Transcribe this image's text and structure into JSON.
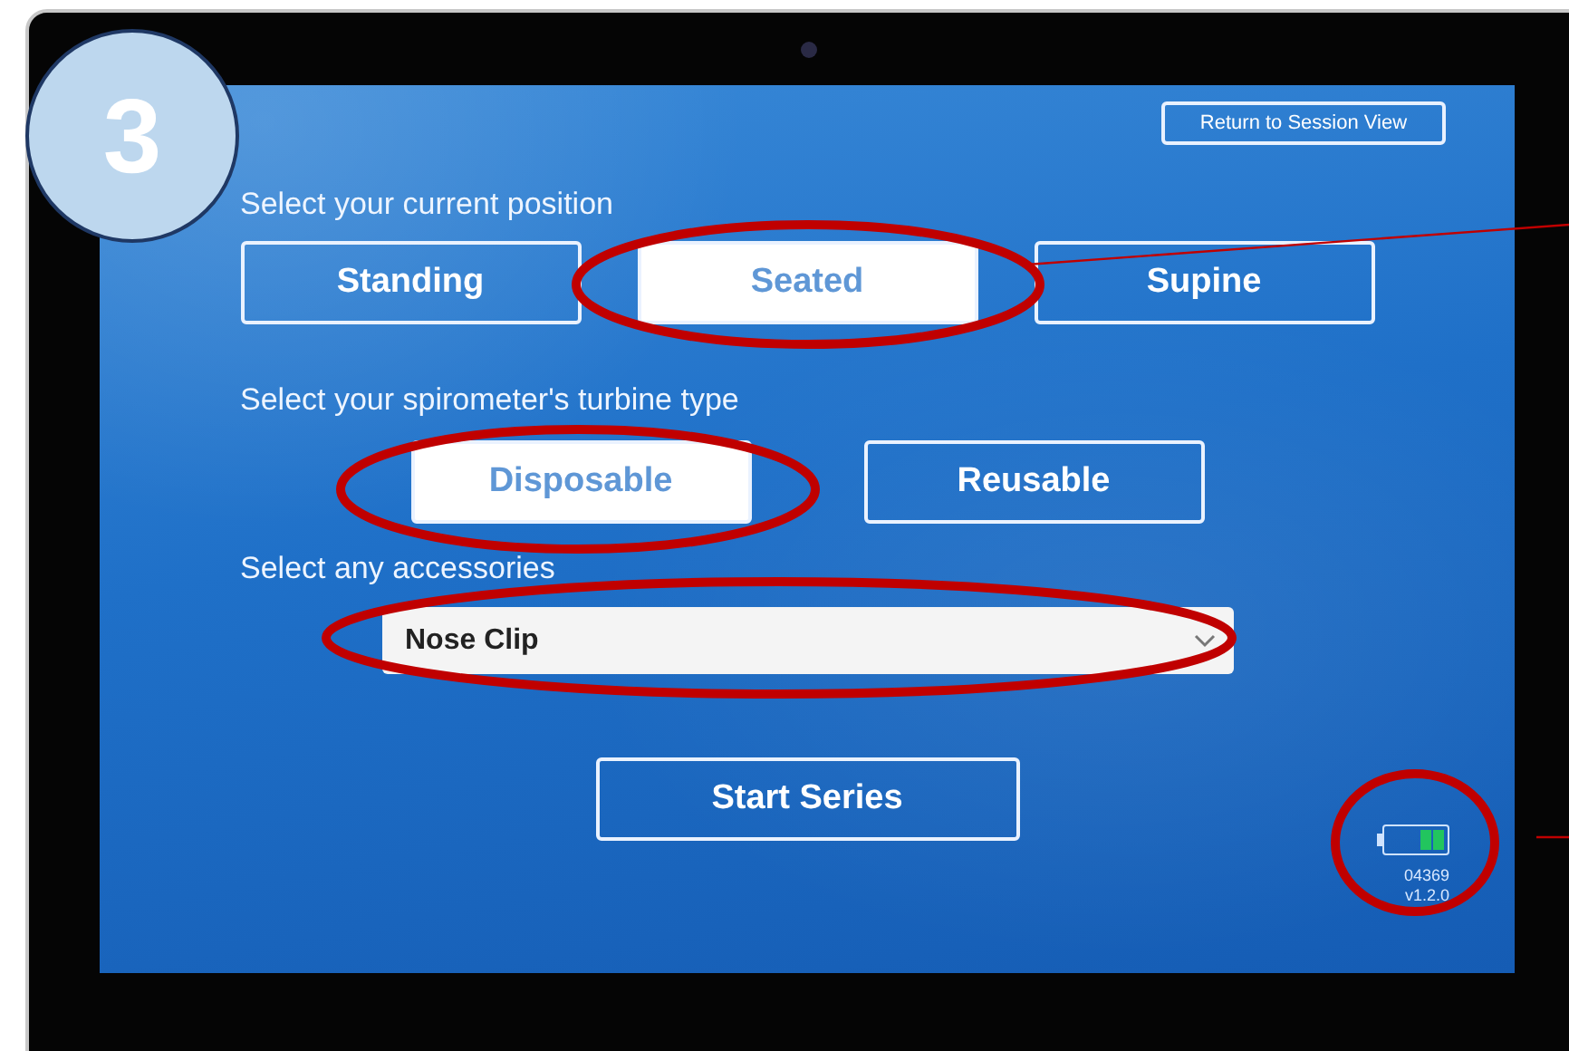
{
  "step_badge": "3",
  "return_button": "Return to Session View",
  "position": {
    "label": "Select your current position",
    "options": [
      {
        "label": "Standing",
        "selected": false
      },
      {
        "label": "Seated",
        "selected": true
      },
      {
        "label": "Supine",
        "selected": false
      }
    ]
  },
  "turbine": {
    "label": "Select your spirometer's turbine type",
    "options": [
      {
        "label": "Disposable",
        "selected": true
      },
      {
        "label": "Reusable",
        "selected": false
      }
    ]
  },
  "accessories": {
    "label": "Select any accessories",
    "value": "Nose Clip"
  },
  "start_button": "Start Series",
  "device": {
    "serial": "04369",
    "version": "v1.2.0"
  }
}
